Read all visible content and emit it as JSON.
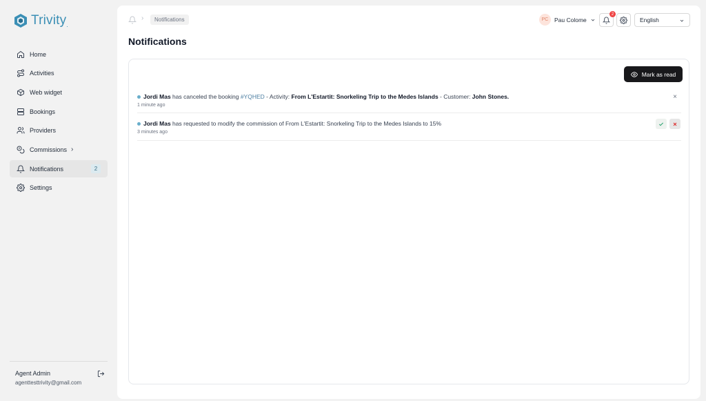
{
  "brand": {
    "name": "Trivity",
    "suffix": "."
  },
  "sidebar": {
    "items": [
      {
        "label": "Home",
        "icon": "home-icon"
      },
      {
        "label": "Activities",
        "icon": "route-icon"
      },
      {
        "label": "Web widget",
        "icon": "cube-icon"
      },
      {
        "label": "Bookings",
        "icon": "server-icon"
      },
      {
        "label": "Providers",
        "icon": "users-icon"
      },
      {
        "label": "Commissions",
        "icon": "coins-icon",
        "chevron": "›"
      },
      {
        "label": "Notifications",
        "icon": "bell-icon",
        "badge": "2",
        "active": true
      },
      {
        "label": "Settings",
        "icon": "gear-icon"
      }
    ],
    "user": {
      "name": "Agent Admin",
      "email": "agenttesttrivity@gmail.com"
    }
  },
  "header": {
    "breadcrumb": "Notifications",
    "user_initials": "PC",
    "user_name": "Pau Colome",
    "notifications_count": "2",
    "language": "English"
  },
  "page": {
    "title": "Notifications",
    "mark_read_label": "Mark as read"
  },
  "notifications": [
    {
      "actor": "Jordi Mas",
      "text1": " has canceled the booking ",
      "booking": "#YQHED",
      "text2": " - Activity: ",
      "activity": "From L'Estartit: Snorkeling Trip to the Medes Islands",
      "text3": " - Customer: ",
      "customer": "John Stones.",
      "time": "1 minute ago",
      "dismiss": "×"
    },
    {
      "actor": "Jordi Mas",
      "text1": " has requested to modify the commission of From L'Estartit: Snorkeling Trip to the Medes Islands to 15%",
      "time": "3 minutes ago"
    }
  ],
  "colors": {
    "brand": "#3b8fb5",
    "dark_button": "#18181b",
    "badge_red": "#ef4444"
  }
}
